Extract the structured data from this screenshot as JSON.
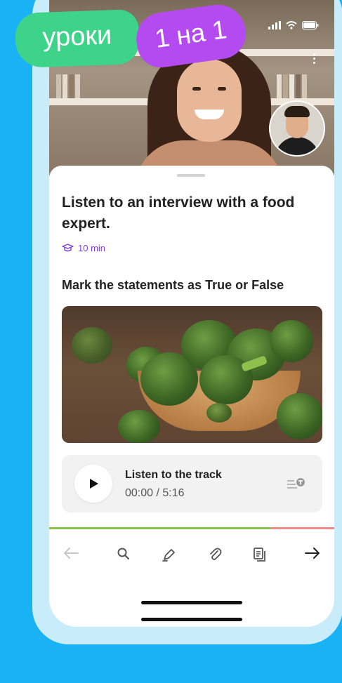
{
  "promo": {
    "tag_primary": "уроки",
    "tag_secondary": "1 на 1"
  },
  "status_bar": {
    "icons": [
      "signal-icon",
      "wifi-icon",
      "battery-icon"
    ]
  },
  "video_call": {
    "more_icon": "more-vertical-icon"
  },
  "lesson": {
    "title": "Listen to an interview with a food expert.",
    "duration": "10 min",
    "duration_icon": "graduation-cap-icon",
    "instruction": "Mark the statements as True or False"
  },
  "player": {
    "track_title": "Listen to the track",
    "time": "00:00 / 5:16",
    "play_icon": "play-icon",
    "transcript_icon": "transcript-icon"
  },
  "toolbar": {
    "items": [
      "back-arrow-icon",
      "search-icon",
      "highlighter-icon",
      "attachment-icon",
      "notes-icon",
      "forward-arrow-icon"
    ]
  },
  "colors": {
    "background": "#19b3f5",
    "accent_purple": "#7b3fe4",
    "tag_green": "#3dd489",
    "tag_purple": "#b44bf0",
    "progress_done": "#8bc34a",
    "progress_rest": "#f28a8a"
  }
}
